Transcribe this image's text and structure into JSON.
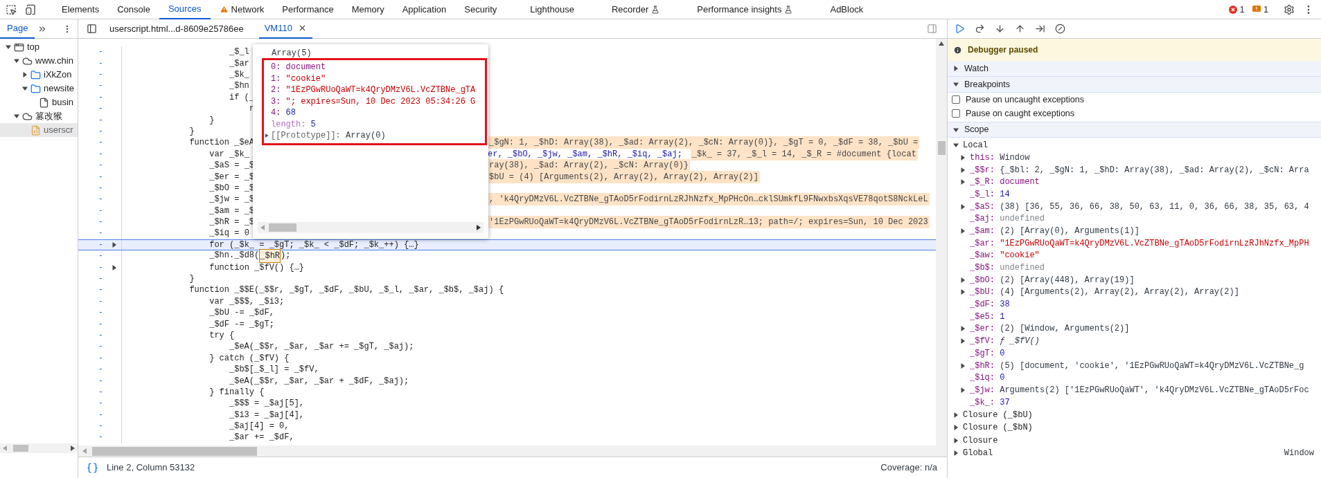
{
  "main_tabs": [
    {
      "label": "Elements",
      "selected": false,
      "kind": "plain"
    },
    {
      "label": "Console",
      "selected": false,
      "kind": "plain"
    },
    {
      "label": "Sources",
      "selected": true,
      "kind": "plain"
    },
    {
      "label": "Network",
      "selected": false,
      "kind": "warning"
    },
    {
      "label": "Performance",
      "selected": false,
      "kind": "plain"
    },
    {
      "label": "Memory",
      "selected": false,
      "kind": "plain"
    },
    {
      "label": "Application",
      "selected": false,
      "kind": "plain"
    },
    {
      "label": "Security",
      "selected": false,
      "kind": "plain"
    },
    {
      "label": "Lighthouse",
      "selected": false,
      "kind": "plain"
    },
    {
      "label": "Recorder",
      "selected": false,
      "kind": "flask"
    },
    {
      "label": "Performance insights",
      "selected": false,
      "kind": "flask"
    },
    {
      "label": "AdBlock",
      "selected": false,
      "kind": "plain"
    }
  ],
  "issues": {
    "errors": "1",
    "warnings": "1"
  },
  "navigator": {
    "tabs": [
      {
        "label": "Page",
        "selected": true
      }
    ],
    "tree": [
      {
        "label": "top",
        "kind": "frame",
        "expanded": true,
        "selected": false,
        "children": [
          {
            "label": "www.chin",
            "kind": "cloud",
            "expanded": true,
            "selected": false,
            "children": [
              {
                "label": "iXkZon",
                "kind": "folder",
                "expanded": false,
                "selected": false
              },
              {
                "label": "newsite",
                "kind": "folder",
                "expanded": true,
                "selected": false,
                "children": [
                  {
                    "label": "busin",
                    "kind": "file",
                    "selected": false
                  }
                ]
              }
            ]
          },
          {
            "label": "篡改猴",
            "kind": "cloud",
            "expanded": true,
            "selected": false,
            "children": [
              {
                "label": "userscr",
                "kind": "script",
                "selected": true
              }
            ]
          }
        ]
      }
    ]
  },
  "editor_tabs": [
    {
      "label": "userscript.html...d-8609e25786ee",
      "selected": false,
      "closable": false
    },
    {
      "label": "VM110",
      "selected": true,
      "closable": true
    }
  ],
  "code_lines": [
    {
      "marker": "-",
      "code": "                    _$_l"
    },
    {
      "marker": "-",
      "code": "                    _$ar"
    },
    {
      "marker": "-",
      "code": "                    _$k_"
    },
    {
      "marker": "-",
      "code": "                    _$hn"
    },
    {
      "marker": "-",
      "code": "                    if (_"
    },
    {
      "marker": "-",
      "code": "                        r"
    },
    {
      "marker": "-",
      "code": "                }"
    },
    {
      "marker": "-",
      "code": "            }"
    },
    {
      "marker": "-",
      "code": "            function _$eA",
      "annotation": "_$gN: 1, _$hD: Array(38), _$ad: Array(2), _$cN: Array(0)}, _$gT = 0, _$dF = 38, _$bU ="
    },
    {
      "marker": "-",
      "code": "                var _$k_",
      "code_right": "er, _$bO, _$jw, _$am, _$hR, _$iq, _$aj;",
      "annotation": "_$k_ = 37, _$_l = 14, _$_R = #document {locat"
    },
    {
      "marker": "-",
      "code": "                _$aS = _$",
      "annotation": "ray(38), _$ad: Array(2), _$cN: Array(0)}"
    },
    {
      "marker": "-",
      "code": "                _$er = _$",
      "annotation": "$bU = (4) [Arguments(2), Array(2), Array(2), Array(2)]"
    },
    {
      "marker": "-",
      "code": "                _$bO = _$"
    },
    {
      "marker": "-",
      "code": "                _$jw = _$",
      "annotation": ", 'k4QryDMzV6L.VcZTBNe_gTAoD5rFodirnLzRJhNzfx_MpPHcOn…cklSUmkfL9FNwxbsXqsVE78qotS8NckLeL"
    },
    {
      "marker": "-",
      "code": "                _$am = _$"
    },
    {
      "marker": "-",
      "code": "                _$hR = _$",
      "annotation": "'1EzPGwRUoQaWT=k4QryDMzV6L.VcZTBNe_gTAoD5rFodirnLzR…13; path=/; expires=Sun, 10 Dec 2023"
    },
    {
      "marker": "-",
      "code": "                _$iq = 0"
    },
    {
      "marker": "-",
      "code": "                for (_$k_ = _$gT; _$k_ < _$dF; _$k_++) {…}",
      "current": true,
      "foldable": true
    },
    {
      "marker": "-",
      "code": "                _$hn._$d8(",
      "token": "_$hR",
      "code_after": ");"
    },
    {
      "marker": "-",
      "code": "                function _$fV() {…}",
      "foldable": true
    },
    {
      "marker": "-",
      "code": "            }"
    },
    {
      "marker": "-",
      "code": "            function _$$E(_$$r, _$gT, _$dF, _$bU, _$_l, _$ar, _$b$, _$aj) {"
    },
    {
      "marker": "-",
      "code": "                var _$$$, _$i3;"
    },
    {
      "marker": "-",
      "code": "                _$bU -= _$dF,"
    },
    {
      "marker": "-",
      "code": "                _$dF -= _$gT;"
    },
    {
      "marker": "-",
      "code": "                try {"
    },
    {
      "marker": "-",
      "code": "                    _$eA(_$$r, _$ar, _$ar += _$gT, _$aj);"
    },
    {
      "marker": "-",
      "code": "                } catch (_$fV) {"
    },
    {
      "marker": "-",
      "code": "                    _$b$[_$_l] = _$fV,"
    },
    {
      "marker": "-",
      "code": "                    _$eA(_$$r, _$ar, _$ar + _$dF, _$aj);"
    },
    {
      "marker": "-",
      "code": "                } finally {"
    },
    {
      "marker": "-",
      "code": "                    _$$$ = _$aj[5],"
    },
    {
      "marker": "-",
      "code": "                    _$i3 = _$aj[4],"
    },
    {
      "marker": "-",
      "code": "                    _$aj[4] = 0,"
    },
    {
      "marker": "-",
      "code": "                    _$ar += _$dF,"
    }
  ],
  "popover": {
    "title": "Array(5)",
    "items": [
      {
        "key": "0:",
        "value": "document",
        "kind": "node",
        "internal": false,
        "expandable": false
      },
      {
        "key": "1:",
        "value": "\"cookie\"",
        "kind": "string",
        "internal": false,
        "expandable": false
      },
      {
        "key": "2:",
        "value": "\"1EzPGwRUoQaWT=k4QryDMzV6L.VcZTBNe_gTA",
        "kind": "string",
        "internal": false,
        "expandable": false
      },
      {
        "key": "3:",
        "value": "\"; expires=Sun, 10 Dec 2023 05:34:26 G",
        "kind": "string",
        "internal": false,
        "expandable": false
      },
      {
        "key": "4:",
        "value": "68",
        "kind": "number",
        "internal": false,
        "expandable": false
      },
      {
        "key": "length:",
        "value": "5",
        "kind": "number",
        "internal": true,
        "expandable": false
      },
      {
        "key": "[[Prototype]]:",
        "value": "Array(0)",
        "kind": "object",
        "internal": true,
        "expandable": true
      }
    ]
  },
  "status_bar": {
    "position": "Line 2, Column 53132",
    "coverage": "Coverage: n/a"
  },
  "debugger": {
    "banner": "Debugger paused",
    "sections": [
      {
        "label": "Watch",
        "expanded": false
      },
      {
        "label": "Breakpoints",
        "expanded": true
      }
    ],
    "breakpoint_options": [
      {
        "label": "Pause on uncaught exceptions",
        "checked": false
      },
      {
        "label": "Pause on caught exceptions",
        "checked": false
      }
    ],
    "scope": {
      "label": "Scope",
      "expanded": true,
      "local": {
        "label": "Local",
        "expanded": true,
        "entries": [
          {
            "name": "this:",
            "value": "Window",
            "kind": "object",
            "expandable": true
          },
          {
            "name": "_$$r:",
            "value": "{_$bl: 2, _$gN: 1, _$hD: Array(38), _$ad: Array(2), _$cN: Arra",
            "kind": "object",
            "expandable": true
          },
          {
            "name": "_$_R:",
            "value": "document",
            "kind": "node",
            "expandable": true
          },
          {
            "name": "_$_l:",
            "value": "14",
            "kind": "number",
            "expandable": false
          },
          {
            "name": "_$aS:",
            "value": "(38) [36, 55, 36, 66, 38, 50, 63, 11, 0, 36, 66, 38, 35, 63, 4",
            "kind": "object",
            "expandable": true
          },
          {
            "name": "_$aj:",
            "value": "undefined",
            "kind": "undefined",
            "expandable": false
          },
          {
            "name": "_$am:",
            "value": "(2) [Array(0), Arguments(1)]",
            "kind": "object",
            "expandable": true
          },
          {
            "name": "_$ar:",
            "value": "\"1EzPGwRUoQaWT=k4QryDMzV6L.VcZTBNe_gTAoD5rFodirnLzRJhNzfx_MpPH",
            "kind": "string",
            "expandable": false
          },
          {
            "name": "_$aw:",
            "value": "\"cookie\"",
            "kind": "string",
            "expandable": false
          },
          {
            "name": "_$b$:",
            "value": "undefined",
            "kind": "undefined",
            "expandable": false
          },
          {
            "name": "_$bO:",
            "value": "(2) [Array(448), Array(19)]",
            "kind": "object",
            "expandable": true
          },
          {
            "name": "_$bU:",
            "value": "(4) [Arguments(2), Array(2), Array(2), Array(2)]",
            "kind": "object",
            "expandable": true
          },
          {
            "name": "_$dF:",
            "value": "38",
            "kind": "number",
            "expandable": false
          },
          {
            "name": "_$e5:",
            "value": "1",
            "kind": "number",
            "expandable": false
          },
          {
            "name": "_$er:",
            "value": "(2) [Window, Arguments(2)]",
            "kind": "object",
            "expandable": true
          },
          {
            "name": "_$fV:",
            "value": "ƒ _$fV()",
            "kind": "function",
            "expandable": true
          },
          {
            "name": "_$gT:",
            "value": "0",
            "kind": "number",
            "expandable": false
          },
          {
            "name": "_$hR:",
            "value": "(5) [document, 'cookie', '1EzPGwRUoQaWT=k4QryDMzV6L.VcZTBNe_g",
            "kind": "object",
            "expandable": true
          },
          {
            "name": "_$iq:",
            "value": "0",
            "kind": "number",
            "expandable": false
          },
          {
            "name": "_$jw:",
            "value": "Arguments(2) ['1EzPGwRUoQaWT', 'k4QryDMzV6L.VcZTBNe_gTAoD5rFoc",
            "kind": "object",
            "expandable": true
          },
          {
            "name": "_$k_:",
            "value": "37",
            "kind": "number",
            "expandable": false
          }
        ]
      },
      "groups": [
        {
          "label": "Closure (_$bU)",
          "expanded": false
        },
        {
          "label": "Closure (_$bN)",
          "expanded": false
        },
        {
          "label": "Closure",
          "expanded": false
        },
        {
          "label": "Global",
          "expanded": false,
          "value": "Window"
        }
      ]
    }
  }
}
